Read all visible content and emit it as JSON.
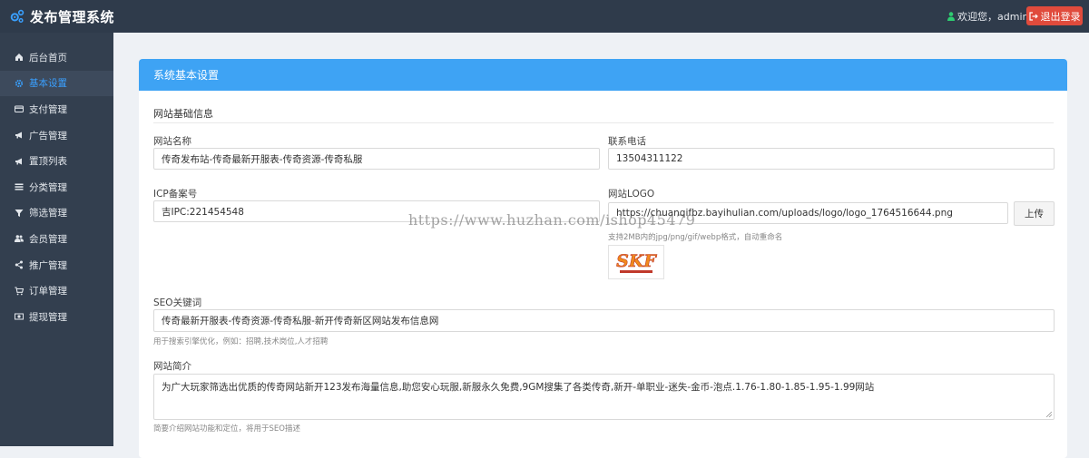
{
  "app": {
    "title": "发布管理系统"
  },
  "header": {
    "welcome": "欢迎您，admin",
    "logout_label": "退出登录"
  },
  "sidebar": {
    "items": [
      {
        "label": "后台首页",
        "icon": "home-icon"
      },
      {
        "label": "基本设置",
        "icon": "gear-icon",
        "active": true
      },
      {
        "label": "支付管理",
        "icon": "credit-card-icon"
      },
      {
        "label": "广告管理",
        "icon": "bullhorn-icon"
      },
      {
        "label": "置顶列表",
        "icon": "bullhorn-icon"
      },
      {
        "label": "分类管理",
        "icon": "list-icon"
      },
      {
        "label": "筛选管理",
        "icon": "filter-icon"
      },
      {
        "label": "会员管理",
        "icon": "users-icon"
      },
      {
        "label": "推广管理",
        "icon": "share-icon"
      },
      {
        "label": "订单管理",
        "icon": "cart-icon"
      },
      {
        "label": "提现管理",
        "icon": "money-icon"
      }
    ]
  },
  "panel": {
    "title": "系统基本设置",
    "section": "网站基础信息",
    "site_name": {
      "label": "网站名称",
      "value": "传奇发布站-传奇最新开服表-传奇资源-传奇私服"
    },
    "phone": {
      "label": "联系电话",
      "value": "13504311122"
    },
    "icp": {
      "label": "ICP备案号",
      "value": "吉IPC:221454548"
    },
    "logo": {
      "label": "网站LOGO",
      "value": "https://chuanqifbz.bayihulian.com/uploads/logo/logo_1764516644.png",
      "upload_label": "上传",
      "hint": "支持2MB内的jpg/png/gif/webp格式，自动重命名",
      "image_text": "SKF"
    },
    "seo_keywords": {
      "label": "SEO关键词",
      "value": "传奇最新开服表-传奇资源-传奇私服-新开传奇新区网站发布信息网",
      "hint": "用于搜索引擎优化，例如：招聘,技术岗位,人才招聘"
    },
    "intro": {
      "label": "网站简介",
      "value": "为广大玩家筛选出优质的传奇网站新开123发布海量信息,助您安心玩服,新服永久免费,9GM搜集了各类传奇,新开-单职业-迷失-金币-泡点.1.76-1.80-1.85-1.95-1.99网站",
      "hint": "简要介绍网站功能和定位，将用于SEO描述"
    }
  },
  "watermark": "https://www.huzhan.com/ishop45479",
  "colors": {
    "topbar": "#2f3b4b",
    "sidebar": "#333f4f",
    "accent": "#3ea3f4",
    "logout": "#e04b3c"
  }
}
